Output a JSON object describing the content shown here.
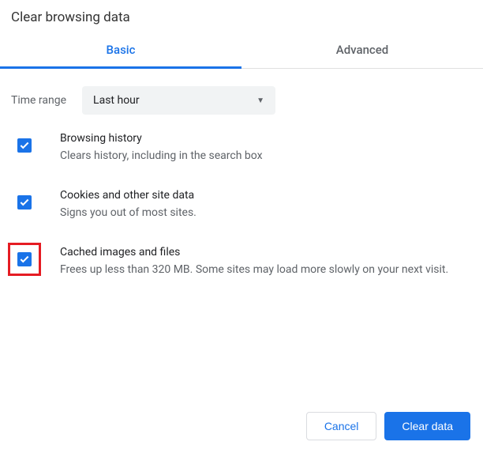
{
  "title": "Clear browsing data",
  "tabs": {
    "basic": "Basic",
    "advanced": "Advanced"
  },
  "time": {
    "label": "Time range",
    "value": "Last hour"
  },
  "options": [
    {
      "title": "Browsing history",
      "desc": "Clears history, including in the search box"
    },
    {
      "title": "Cookies and other site data",
      "desc": "Signs you out of most sites."
    },
    {
      "title": "Cached images and files",
      "desc": "Frees up less than 320 MB. Some sites may load more slowly on your next visit."
    }
  ],
  "buttons": {
    "cancel": "Cancel",
    "clear": "Clear data"
  }
}
